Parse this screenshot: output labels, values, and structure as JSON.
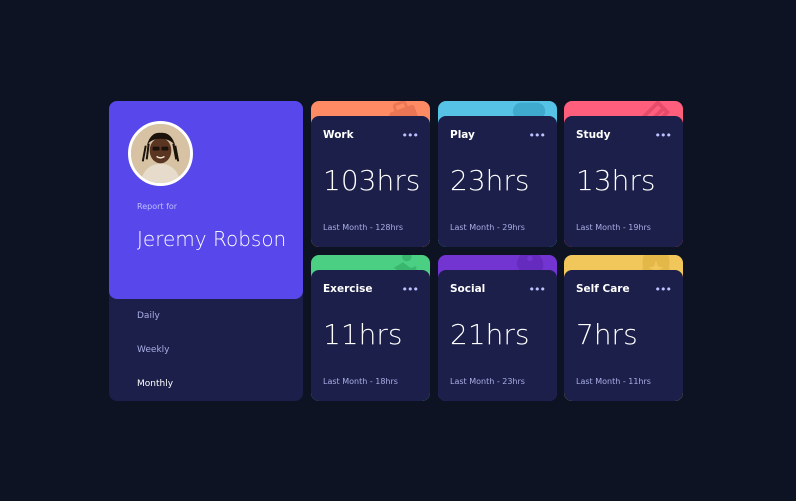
{
  "profile": {
    "report_label": "Report for",
    "name": "Jeremy Robson",
    "periods": [
      "Daily",
      "Weekly",
      "Monthly"
    ],
    "active_period": "Monthly"
  },
  "colors": {
    "background": "#0e1323",
    "card": "#1c1f4a",
    "profile": "#5847eb",
    "work": "#ff8b64",
    "play": "#55c2e6",
    "study": "#ff5e7d",
    "exercise": "#4bcf82",
    "social": "#7335d2",
    "self_care": "#f1c75b"
  },
  "cards": [
    {
      "title": "Work",
      "hours": "103hrs",
      "previous": "Last Month - 128hrs",
      "icon": "briefcase-icon",
      "menu": "•••"
    },
    {
      "title": "Play",
      "hours": "23hrs",
      "previous": "Last Month - 29hrs",
      "icon": "gamepad-icon",
      "menu": "•••"
    },
    {
      "title": "Study",
      "hours": "13hrs",
      "previous": "Last Month - 19hrs",
      "icon": "book-icon",
      "menu": "•••"
    },
    {
      "title": "Exercise",
      "hours": "11hrs",
      "previous": "Last Month - 18hrs",
      "icon": "running-icon",
      "menu": "•••"
    },
    {
      "title": "Social",
      "hours": "21hrs",
      "previous": "Last Month - 23hrs",
      "icon": "social-icon",
      "menu": "•••"
    },
    {
      "title": "Self Care",
      "hours": "7hrs",
      "previous": "Last Month - 11hrs",
      "icon": "self-care-icon",
      "menu": "•••"
    }
  ]
}
